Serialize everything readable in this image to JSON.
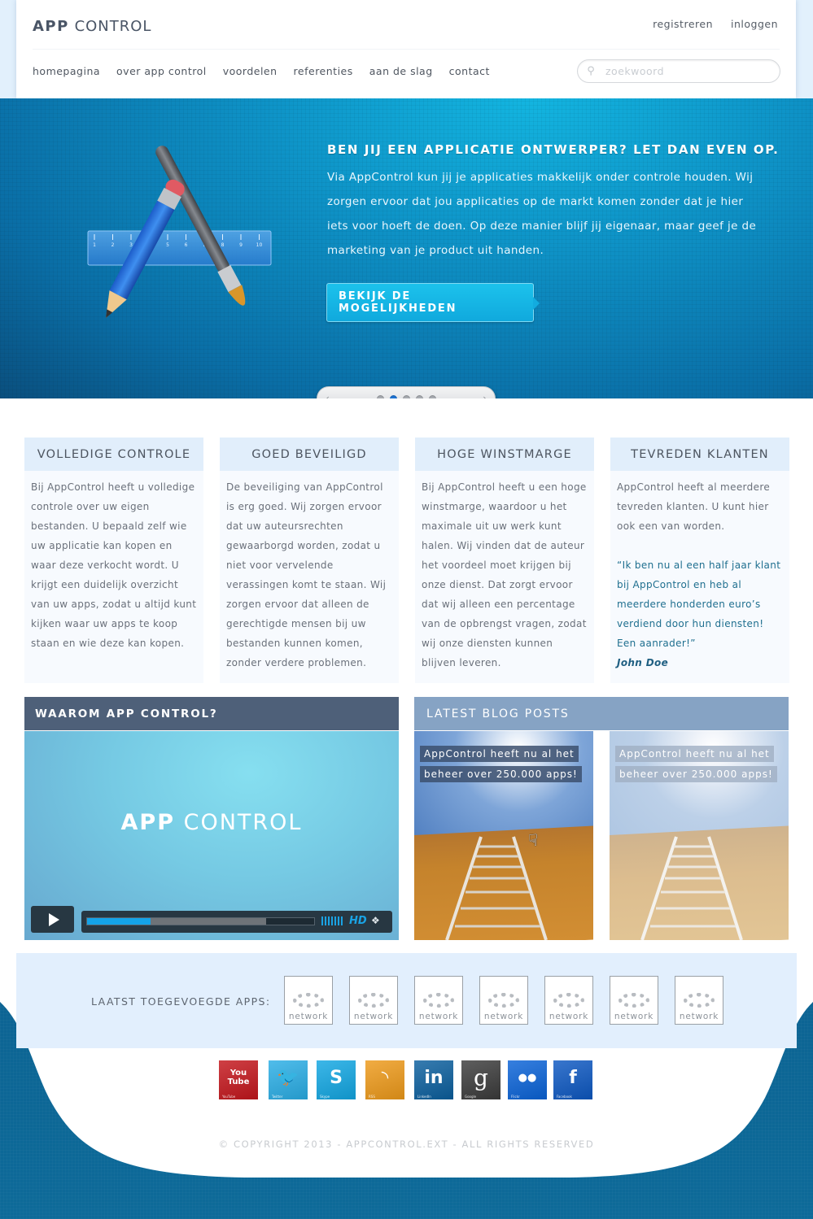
{
  "header": {
    "logo_bold": "APP",
    "logo_light": "CONTROL",
    "top_links": [
      "registreren",
      "inloggen"
    ],
    "nav": [
      "homepagina",
      "over app control",
      "voordelen",
      "referenties",
      "aan de slag",
      "contact"
    ],
    "search": {
      "placeholder": "zoekwoord",
      "value": ""
    }
  },
  "hero": {
    "title": "BEN JIJ EEN APPLICATIE ONTWERPER? LET DAN EVEN OP.",
    "text": "Via AppControl kun jij je applicaties makkelijk onder controle houden. Wij zorgen ervoor dat jou applicaties op de markt komen zonder dat je hier iets voor hoeft de doen. Op deze manier blijf jij eigenaar, maar geef je de marketing van je product uit handen.",
    "button": "BEKIJK DE MOGELIJKHEDEN",
    "ruler_numbers": [
      "1",
      "2",
      "3",
      "4",
      "5",
      "6",
      "7",
      "8",
      "9",
      "10"
    ],
    "slider": {
      "prev": "‹",
      "next": "›",
      "total": 5,
      "active_index": 1
    }
  },
  "features": [
    {
      "title": "VOLLEDIGE CONTROLE",
      "body": "Bij AppControl heeft u volledige controle over uw eigen bestanden. U bepaald zelf wie uw applicatie kan kopen en waar deze verkocht wordt. U krijgt een duidelijk overzicht van uw apps, zodat u altijd kunt kijken waar uw apps te koop staan en wie deze kan kopen."
    },
    {
      "title": "GOED BEVEILIGD",
      "body": "De beveiliging van AppControl is erg goed. Wij zorgen ervoor dat uw auteursrechten gewaarborgd worden, zodat u niet voor vervelende verassingen komt te staan. Wij zorgen ervoor dat alleen de gerechtigde mensen bij uw bestanden kunnen komen, zonder verdere problemen."
    },
    {
      "title": "HOGE WINSTMARGE",
      "body": "Bij AppControl heeft u een hoge winstmarge, waardoor u het maximale uit uw werk kunt halen. Wij vinden dat de auteur het voordeel moet krijgen bij onze dienst. Dat zorgt ervoor dat wij alleen een percentage van de opbrengst vragen, zodat wij onze diensten kunnen blijven leveren."
    },
    {
      "title": "TEVREDEN KLANTEN",
      "body": "AppControl heeft al meerdere tevreden klanten. U kunt hier ook een van worden.",
      "quote": "“Ik ben nu al een half jaar klant bij AppControl en heb al meerdere honderden euro’s verdiend door hun diensten! Een aanrader!”",
      "author": "John Doe"
    }
  ],
  "video": {
    "title": "WAAROM APP CONTROL?",
    "logo_bold": "APP",
    "logo_light": "CONTROL",
    "played_fraction": 0.28,
    "buffered_fraction": 0.79,
    "hd_label": "HD",
    "icons": {
      "play": "play-icon",
      "volume": "volume-icon",
      "fullscreen": "fullscreen-icon"
    }
  },
  "blog": {
    "title": "LATEST BLOG POSTS",
    "posts": [
      {
        "line1": "AppControl heeft nu al het",
        "line2": "beheer over 250.000 apps!"
      },
      {
        "line1": "AppControl heeft nu al het",
        "line2": "beheer over 250.000 apps!"
      }
    ]
  },
  "apps": {
    "label": "LAATST TOEGEVOEGDE APPS:",
    "items": [
      "network",
      "network",
      "network",
      "network",
      "network",
      "network",
      "network"
    ]
  },
  "social": [
    {
      "name": "YouTube",
      "glyph": "You\nTube",
      "color": "#c4161c"
    },
    {
      "name": "Twitter",
      "glyph": "🐦",
      "color": "#2aaee6"
    },
    {
      "name": "Skype",
      "glyph": "S",
      "color": "#12a7e3"
    },
    {
      "name": "RSS",
      "glyph": "◝",
      "color": "#ee9a1a"
    },
    {
      "name": "LinkedIn",
      "glyph": "in",
      "color": "#0b5f9e"
    },
    {
      "name": "Google",
      "glyph": "g",
      "color": "#3b3b3b"
    },
    {
      "name": "Flickr",
      "glyph": "●●",
      "color": "#0a63d8"
    },
    {
      "name": "Facebook",
      "glyph": "f",
      "color": "#0d58c2"
    }
  ],
  "footer": {
    "copyright": "© COPYRIGHT 2013 - APPCONTROL.EXT - ALL RIGHTS RESERVED"
  }
}
